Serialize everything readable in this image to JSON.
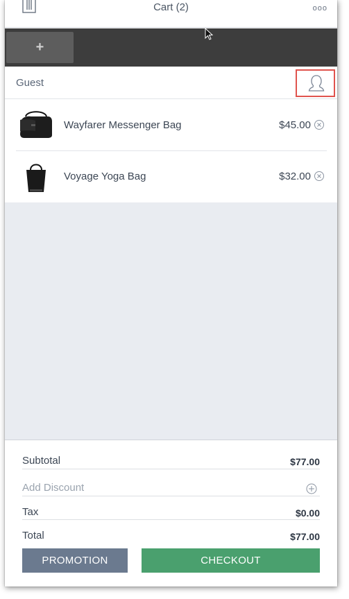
{
  "header": {
    "title": "Cart (2)",
    "more_label": "ooo"
  },
  "tabbar": {
    "add_label": "+"
  },
  "customer": {
    "label": "Guest"
  },
  "items": [
    {
      "name": "Wayfarer Messenger Bag",
      "price": "$45.00",
      "thumb_icon": "messenger-bag-icon"
    },
    {
      "name": "Voyage Yoga Bag",
      "price": "$32.00",
      "thumb_icon": "tote-bag-icon"
    }
  ],
  "totals": {
    "subtotal_label": "Subtotal",
    "subtotal_value": "$77.00",
    "discount_label": "Add Discount",
    "tax_label": "Tax",
    "tax_value": "$0.00",
    "total_label": "Total",
    "total_value": "$77.00"
  },
  "buttons": {
    "promotion": "PROMOTION",
    "checkout": "CHECKOUT"
  },
  "colors": {
    "accent_highlight": "#e0534d",
    "checkout": "#4aa06e",
    "promotion": "#6b7a8f",
    "tabbar": "#3d3d3d"
  }
}
